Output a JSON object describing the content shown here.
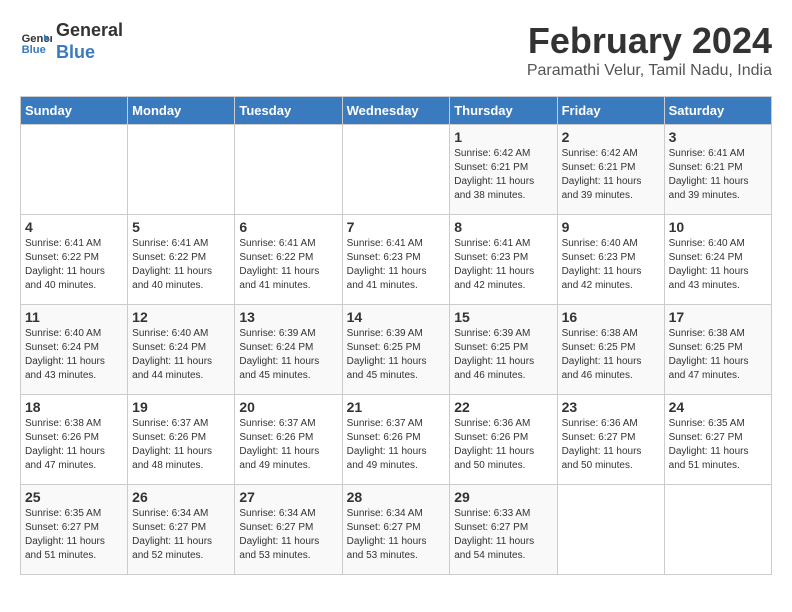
{
  "header": {
    "logo_line1": "General",
    "logo_line2": "Blue",
    "main_title": "February 2024",
    "subtitle": "Paramathi Velur, Tamil Nadu, India"
  },
  "days_of_week": [
    "Sunday",
    "Monday",
    "Tuesday",
    "Wednesday",
    "Thursday",
    "Friday",
    "Saturday"
  ],
  "weeks": [
    [
      {
        "day": "",
        "info": ""
      },
      {
        "day": "",
        "info": ""
      },
      {
        "day": "",
        "info": ""
      },
      {
        "day": "",
        "info": ""
      },
      {
        "day": "1",
        "info": "Sunrise: 6:42 AM\nSunset: 6:21 PM\nDaylight: 11 hours\nand 38 minutes."
      },
      {
        "day": "2",
        "info": "Sunrise: 6:42 AM\nSunset: 6:21 PM\nDaylight: 11 hours\nand 39 minutes."
      },
      {
        "day": "3",
        "info": "Sunrise: 6:41 AM\nSunset: 6:21 PM\nDaylight: 11 hours\nand 39 minutes."
      }
    ],
    [
      {
        "day": "4",
        "info": "Sunrise: 6:41 AM\nSunset: 6:22 PM\nDaylight: 11 hours\nand 40 minutes."
      },
      {
        "day": "5",
        "info": "Sunrise: 6:41 AM\nSunset: 6:22 PM\nDaylight: 11 hours\nand 40 minutes."
      },
      {
        "day": "6",
        "info": "Sunrise: 6:41 AM\nSunset: 6:22 PM\nDaylight: 11 hours\nand 41 minutes."
      },
      {
        "day": "7",
        "info": "Sunrise: 6:41 AM\nSunset: 6:23 PM\nDaylight: 11 hours\nand 41 minutes."
      },
      {
        "day": "8",
        "info": "Sunrise: 6:41 AM\nSunset: 6:23 PM\nDaylight: 11 hours\nand 42 minutes."
      },
      {
        "day": "9",
        "info": "Sunrise: 6:40 AM\nSunset: 6:23 PM\nDaylight: 11 hours\nand 42 minutes."
      },
      {
        "day": "10",
        "info": "Sunrise: 6:40 AM\nSunset: 6:24 PM\nDaylight: 11 hours\nand 43 minutes."
      }
    ],
    [
      {
        "day": "11",
        "info": "Sunrise: 6:40 AM\nSunset: 6:24 PM\nDaylight: 11 hours\nand 43 minutes."
      },
      {
        "day": "12",
        "info": "Sunrise: 6:40 AM\nSunset: 6:24 PM\nDaylight: 11 hours\nand 44 minutes."
      },
      {
        "day": "13",
        "info": "Sunrise: 6:39 AM\nSunset: 6:24 PM\nDaylight: 11 hours\nand 45 minutes."
      },
      {
        "day": "14",
        "info": "Sunrise: 6:39 AM\nSunset: 6:25 PM\nDaylight: 11 hours\nand 45 minutes."
      },
      {
        "day": "15",
        "info": "Sunrise: 6:39 AM\nSunset: 6:25 PM\nDaylight: 11 hours\nand 46 minutes."
      },
      {
        "day": "16",
        "info": "Sunrise: 6:38 AM\nSunset: 6:25 PM\nDaylight: 11 hours\nand 46 minutes."
      },
      {
        "day": "17",
        "info": "Sunrise: 6:38 AM\nSunset: 6:25 PM\nDaylight: 11 hours\nand 47 minutes."
      }
    ],
    [
      {
        "day": "18",
        "info": "Sunrise: 6:38 AM\nSunset: 6:26 PM\nDaylight: 11 hours\nand 47 minutes."
      },
      {
        "day": "19",
        "info": "Sunrise: 6:37 AM\nSunset: 6:26 PM\nDaylight: 11 hours\nand 48 minutes."
      },
      {
        "day": "20",
        "info": "Sunrise: 6:37 AM\nSunset: 6:26 PM\nDaylight: 11 hours\nand 49 minutes."
      },
      {
        "day": "21",
        "info": "Sunrise: 6:37 AM\nSunset: 6:26 PM\nDaylight: 11 hours\nand 49 minutes."
      },
      {
        "day": "22",
        "info": "Sunrise: 6:36 AM\nSunset: 6:26 PM\nDaylight: 11 hours\nand 50 minutes."
      },
      {
        "day": "23",
        "info": "Sunrise: 6:36 AM\nSunset: 6:27 PM\nDaylight: 11 hours\nand 50 minutes."
      },
      {
        "day": "24",
        "info": "Sunrise: 6:35 AM\nSunset: 6:27 PM\nDaylight: 11 hours\nand 51 minutes."
      }
    ],
    [
      {
        "day": "25",
        "info": "Sunrise: 6:35 AM\nSunset: 6:27 PM\nDaylight: 11 hours\nand 51 minutes."
      },
      {
        "day": "26",
        "info": "Sunrise: 6:34 AM\nSunset: 6:27 PM\nDaylight: 11 hours\nand 52 minutes."
      },
      {
        "day": "27",
        "info": "Sunrise: 6:34 AM\nSunset: 6:27 PM\nDaylight: 11 hours\nand 53 minutes."
      },
      {
        "day": "28",
        "info": "Sunrise: 6:34 AM\nSunset: 6:27 PM\nDaylight: 11 hours\nand 53 minutes."
      },
      {
        "day": "29",
        "info": "Sunrise: 6:33 AM\nSunset: 6:27 PM\nDaylight: 11 hours\nand 54 minutes."
      },
      {
        "day": "",
        "info": ""
      },
      {
        "day": "",
        "info": ""
      }
    ]
  ]
}
